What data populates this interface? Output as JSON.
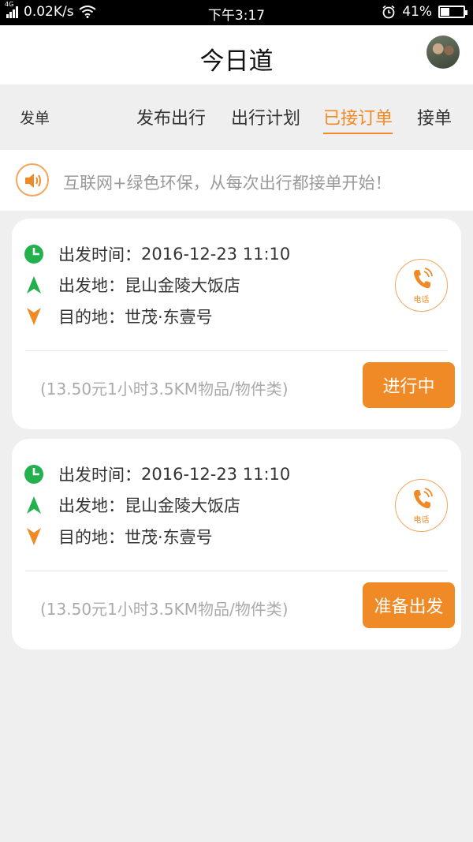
{
  "status_bar": {
    "network": "4G",
    "speed": "0.02K/s",
    "time": "下午3:17",
    "battery_text": "41%",
    "battery_level": 0.41
  },
  "header": {
    "title": "今日道"
  },
  "tabs": {
    "left": "发单",
    "items": [
      {
        "label": "发布出行"
      },
      {
        "label": "出行计划"
      },
      {
        "label": "已接订单",
        "active": true
      },
      {
        "label": "接单"
      }
    ]
  },
  "notice": {
    "text": "互联网+绿色环保，从每次出行都接单开始！",
    "icon": "speaker-icon"
  },
  "orders": [
    {
      "depart_time_label": "出发时间：",
      "depart_time": "2016-12-23 11:10",
      "origin_label": "出发地：",
      "origin": "昆山金陵大饭店",
      "dest_label": "目的地：",
      "dest": "世茂·东壹号",
      "call_label": "电话",
      "summary": "(13.50元1小时3.5KM物品/物件类)",
      "action": "进行中"
    },
    {
      "depart_time_label": "出发时间：",
      "depart_time": "2016-12-23 11:10",
      "origin_label": "出发地：",
      "origin": "昆山金陵大饭店",
      "dest_label": "目的地：",
      "dest": "世茂·东壹号",
      "call_label": "电话",
      "summary": "(13.50元1小时3.5KM物品/物件类)",
      "action": "准备出发"
    }
  ],
  "colors": {
    "accent": "#f08a26",
    "green": "#22b14c",
    "background": "#efefef"
  }
}
